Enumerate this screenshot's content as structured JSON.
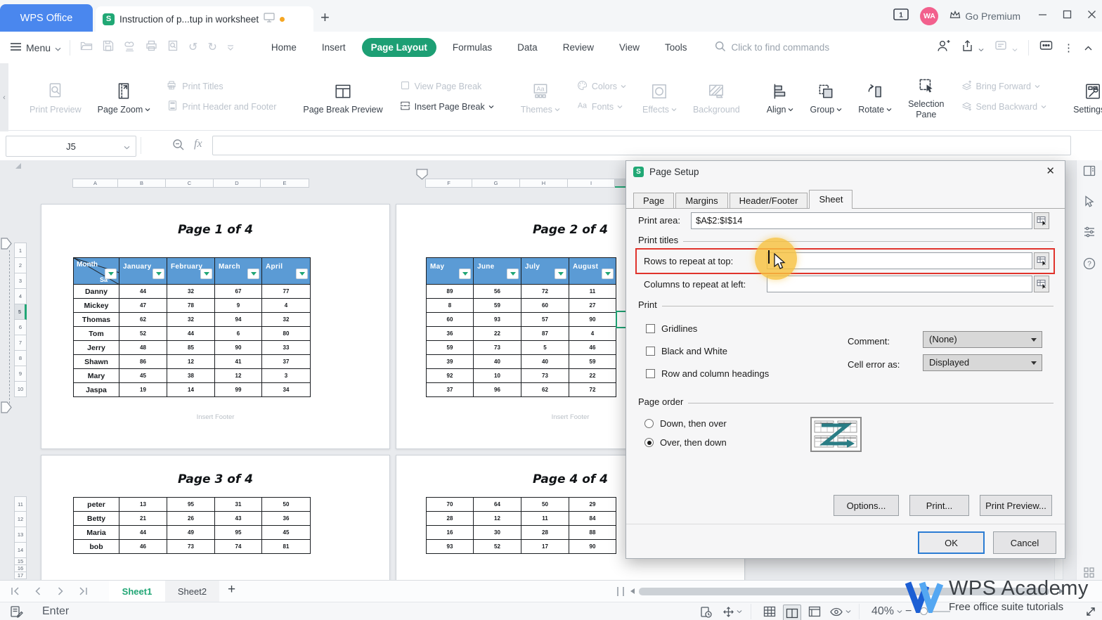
{
  "colors": {
    "wps_blue": "#4a87ee",
    "wps_green": "#21a675",
    "table_header_blue": "#5b9bd5",
    "highlight_red": "#e0332c",
    "highlight_yellow": "#f6c13e",
    "ok_blue": "#2b7cd3"
  },
  "titlebar": {
    "app_tab": "WPS Office",
    "doc_tab": "Instruction of p...tup in worksheet",
    "window_badge": "1",
    "avatar_initials": "WA",
    "go_premium": "Go Premium"
  },
  "menubar": {
    "menu": "Menu",
    "tabs": [
      "Home",
      "Insert",
      "Page Layout",
      "Formulas",
      "Data",
      "Review",
      "View",
      "Tools"
    ],
    "active_tab": "Page Layout",
    "search_placeholder": "Click to find commands"
  },
  "ribbon": {
    "groups": [
      {
        "type": "item",
        "icon": "print-preview-icon",
        "label": "Print Preview",
        "enabled": false,
        "dropdown": false
      },
      {
        "type": "item",
        "icon": "page-zoom-icon",
        "label": "Page Zoom",
        "enabled": true,
        "dropdown": true
      },
      {
        "type": "stack",
        "items": [
          {
            "icon": "print-titles-icon",
            "label": "Print Titles",
            "enabled": false,
            "dropdown": false
          },
          {
            "icon": "print-header-footer-icon",
            "label": "Print Header and Footer",
            "enabled": false,
            "dropdown": false
          }
        ]
      },
      {
        "type": "sep"
      },
      {
        "type": "item",
        "icon": "page-break-preview-icon",
        "label": "Page Break Preview",
        "enabled": true,
        "dropdown": false
      },
      {
        "type": "stack",
        "items": [
          {
            "icon": "checkbox-icon",
            "label": "View Page Break",
            "enabled": false,
            "dropdown": false
          },
          {
            "icon": "insert-page-break-icon",
            "label": "Insert Page Break",
            "enabled": true,
            "dropdown": true
          }
        ]
      },
      {
        "type": "sep"
      },
      {
        "type": "item",
        "icon": "themes-icon",
        "label": "Themes",
        "enabled": false,
        "dropdown": true
      },
      {
        "type": "stack",
        "items": [
          {
            "icon": "colors-icon",
            "label": "Colors",
            "enabled": false,
            "dropdown": true
          },
          {
            "icon": "fonts-icon",
            "label": "Fonts",
            "enabled": false,
            "dropdown": true
          }
        ]
      },
      {
        "type": "item",
        "icon": "effects-icon",
        "label": "Effects",
        "enabled": false,
        "dropdown": true
      },
      {
        "type": "item",
        "icon": "background-icon",
        "label": "Background",
        "enabled": false,
        "dropdown": false
      },
      {
        "type": "sep"
      },
      {
        "type": "item",
        "icon": "align-icon",
        "label": "Align",
        "enabled": true,
        "dropdown": true
      },
      {
        "type": "item",
        "icon": "group-icon",
        "label": "Group",
        "enabled": true,
        "dropdown": true
      },
      {
        "type": "item",
        "icon": "rotate-icon",
        "label": "Rotate",
        "enabled": true,
        "dropdown": true
      },
      {
        "type": "item",
        "icon": "selection-pane-icon",
        "label": "Selection Pane",
        "enabled": true,
        "dropdown": false,
        "twoline": true
      },
      {
        "type": "stack",
        "items": [
          {
            "icon": "bring-forward-icon",
            "label": "Bring Forward",
            "enabled": false,
            "dropdown": true
          },
          {
            "icon": "send-backward-icon",
            "label": "Send Backward",
            "enabled": false,
            "dropdown": true
          }
        ]
      },
      {
        "type": "sep"
      },
      {
        "type": "item",
        "icon": "settings-icon",
        "label": "Settings",
        "enabled": true,
        "dropdown": true
      }
    ]
  },
  "formula_bar": {
    "name_box": "J5",
    "fx": "fx",
    "formula_value": ""
  },
  "grid": {
    "col_headers_left": [
      "A",
      "B",
      "C",
      "D",
      "E"
    ],
    "col_headers_right": [
      "F",
      "G",
      "H",
      "I"
    ],
    "row_numbers_top": [
      "1",
      "2",
      "3",
      "4",
      "5",
      "6",
      "7",
      "8",
      "9",
      "10"
    ],
    "row_numbers_bottom": [
      "11",
      "12",
      "13",
      "14",
      "15",
      "16",
      "17"
    ],
    "selected_row": "5",
    "selected_cell": "J5"
  },
  "pages": [
    {
      "title": "Page 1 of 4",
      "footer": "Insert Footer",
      "table": {
        "corner_top": "Month",
        "corner_bottom": "Sa",
        "headers": [
          "January",
          "February",
          "March",
          "April"
        ],
        "rows": [
          [
            "Danny",
            44,
            32,
            67,
            77
          ],
          [
            "Mickey",
            47,
            78,
            9,
            4
          ],
          [
            "Thomas",
            62,
            32,
            94,
            32
          ],
          [
            "Tom",
            52,
            44,
            6,
            80
          ],
          [
            "Jerry",
            48,
            85,
            90,
            33
          ],
          [
            "Shawn",
            86,
            12,
            41,
            37
          ],
          [
            "Mary",
            45,
            38,
            12,
            3
          ],
          [
            "Jaspa",
            19,
            14,
            99,
            34
          ]
        ]
      }
    },
    {
      "title": "Page 2 of 4",
      "footer": "Insert Footer",
      "table": {
        "headers": [
          "May",
          "June",
          "July",
          "August"
        ],
        "rows": [
          [
            89,
            56,
            72,
            11
          ],
          [
            8,
            59,
            60,
            27
          ],
          [
            60,
            93,
            57,
            90
          ],
          [
            36,
            22,
            87,
            4
          ],
          [
            59,
            73,
            5,
            46
          ],
          [
            39,
            40,
            40,
            59
          ],
          [
            92,
            10,
            73,
            22
          ],
          [
            37,
            96,
            62,
            72
          ]
        ]
      }
    },
    {
      "title": "Page 3 of 4",
      "footer": "",
      "table": {
        "rows": [
          [
            "peter",
            13,
            95,
            31,
            50
          ],
          [
            "Betty",
            21,
            26,
            43,
            36
          ],
          [
            "Maria",
            44,
            49,
            95,
            45
          ],
          [
            "bob",
            46,
            73,
            74,
            81
          ]
        ]
      }
    },
    {
      "title": "Page 4 of 4",
      "footer": "",
      "table": {
        "rows": [
          [
            70,
            64,
            50,
            29
          ],
          [
            28,
            12,
            11,
            84
          ],
          [
            16,
            30,
            28,
            88
          ],
          [
            93,
            52,
            17,
            90
          ]
        ]
      }
    }
  ],
  "page_setup": {
    "title": "Page Setup",
    "tabs": [
      "Page",
      "Margins",
      "Header/Footer",
      "Sheet"
    ],
    "active_tab": "Sheet",
    "print_area_label": "Print area:",
    "print_area_value": "$A$2:$I$14",
    "print_titles_group": "Print titles",
    "rows_repeat_label": "Rows to repeat at top:",
    "rows_repeat_value": "",
    "cols_repeat_label": "Columns to repeat at left:",
    "cols_repeat_value": "",
    "print_group": "Print",
    "checkboxes": [
      {
        "label": "Gridlines",
        "checked": false
      },
      {
        "label": "Black and White",
        "checked": false
      },
      {
        "label": "Row and column headings",
        "checked": false
      }
    ],
    "comment_label": "Comment:",
    "comment_value": "(None)",
    "cell_error_label": "Cell error as:",
    "cell_error_value": "Displayed",
    "page_order_group": "Page order",
    "page_order_options": [
      {
        "label": "Down, then over",
        "selected": false
      },
      {
        "label": "Over, then down",
        "selected": true
      }
    ],
    "buttons": {
      "options": "Options...",
      "print": "Print...",
      "print_preview": "Print Preview...",
      "ok": "OK",
      "cancel": "Cancel"
    }
  },
  "sheet_bar": {
    "sheets": [
      "Sheet1",
      "Sheet2"
    ],
    "active_sheet": "Sheet1"
  },
  "status_bar": {
    "mode": "Enter",
    "zoom_level": "40%"
  },
  "watermark": {
    "brand": "WPS Academy",
    "tagline": "Free office suite tutorials"
  }
}
